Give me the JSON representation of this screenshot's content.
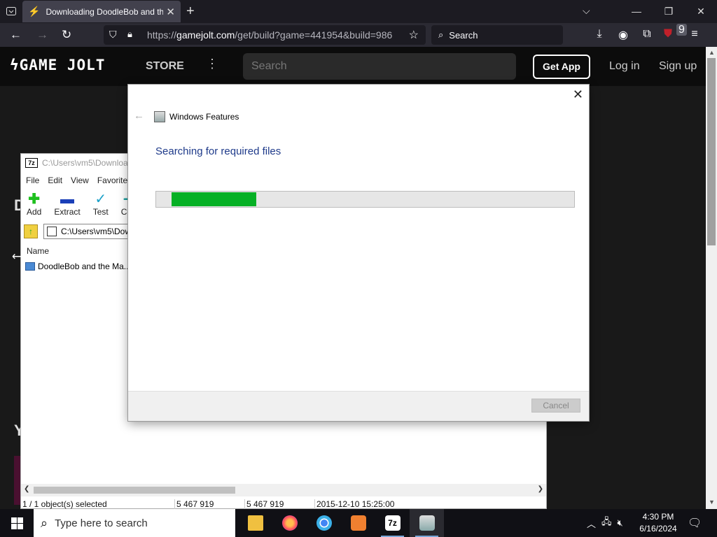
{
  "browser": {
    "tab_title": "Downloading DoodleBob and the M",
    "url_prefix": "https://",
    "url_host": "gamejolt.com",
    "url_path": "/get/build?game=441954&build=986",
    "search_placeholder": "Search",
    "badge_count": "9"
  },
  "gamejolt": {
    "logo": "GAME JOLT",
    "store": "STORE",
    "search_placeholder": "Search",
    "get_app": "Get App",
    "login": "Log in",
    "signup": "Sign up",
    "bg_letter1": "D",
    "bg_letter2": "Y"
  },
  "sevenzip": {
    "title": "C:\\Users\\vm5\\Downloa",
    "title_icon": "7z",
    "menu": [
      "File",
      "Edit",
      "View",
      "Favorite"
    ],
    "toolbar": [
      "Add",
      "Extract",
      "Test",
      "Cop"
    ],
    "path": "C:\\Users\\vm5\\Dow",
    "col_name": "Name",
    "file_name": "DoodleBob and the Ma...",
    "status": {
      "selected": "1 / 1 object(s) selected",
      "size": "5 467 919",
      "packed": "5 467 919",
      "modified": "2015-12-10 15:25:00"
    }
  },
  "dialog": {
    "title": "Windows Features",
    "status": "Searching for required files",
    "progress": 0.21,
    "cancel": "Cancel"
  },
  "taskbar": {
    "search_placeholder": "Type here to search",
    "time": "4:30 PM",
    "date": "6/16/2024",
    "apps": [
      "file-explorer-icon",
      "firefox-icon",
      "chrome-icon",
      "app-icon",
      "7zip-icon",
      "windows-features-icon"
    ]
  },
  "colors": {
    "progress_fill": "#06b025",
    "status_text": "#1e3a8a"
  }
}
